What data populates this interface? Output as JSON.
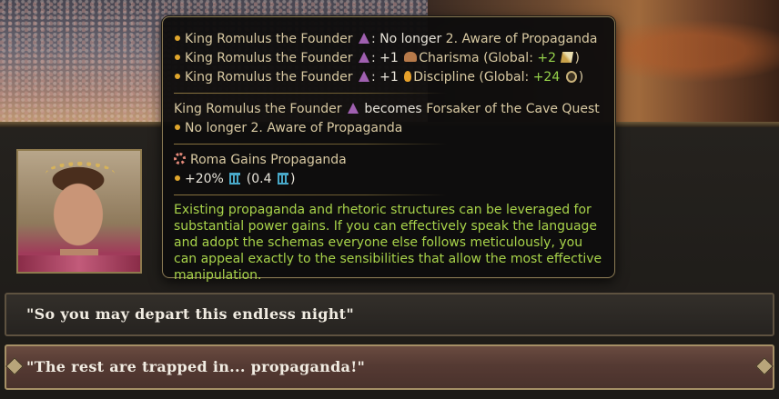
{
  "tooltip": {
    "effects": [
      {
        "name": "King Romulus the Founder",
        "text": ": No longer ",
        "value": "2. Aware of Propaganda"
      },
      {
        "name": "King Romulus the Founder",
        "text": ": +1 ",
        "stat": "Charisma",
        "global_prefix": " (Global: ",
        "global_value": "+2",
        "global_suffix": ")"
      },
      {
        "name": "King Romulus the Founder",
        "text": ": +1 ",
        "stat": "Discipline",
        "global_prefix": " (Global: ",
        "global_value": "+24",
        "global_suffix": ")"
      }
    ],
    "quest": {
      "name": "King Romulus the Founder",
      "becomes": " becomes ",
      "quest_name": "Forsaker of the Cave Quest",
      "no_longer": "No longer 2. Aware of Propaganda"
    },
    "gain": {
      "title": "Roma Gains Propaganda",
      "value": "+20%",
      "paren_open": " (0.4 ",
      "paren_close": ")"
    },
    "description": "Existing propaganda and rhetoric structures can be leveraged for substantial power gains. If you can effectively speak the language and adopt the schemas everyone else follows meticulously, you can appeal exactly to the sensibilities that allow the most effective manipulation."
  },
  "choices": [
    {
      "label": "\"So you may depart this endless night\""
    },
    {
      "label": "\"The rest are trapped in... propaganda!\""
    }
  ],
  "icons": {
    "character": "character-triangle-icon",
    "charisma": "charisma-heart-icon",
    "discipline": "discipline-flame-icon",
    "global_charisma": "quill-icon",
    "global_discipline": "medal-icon",
    "propaganda": "propaganda-gear-icon",
    "structure": "pillar-icon"
  },
  "colors": {
    "accent_green": "#95d14a",
    "gold_text": "#d8c9a2",
    "bullet": "#e0a62c",
    "character_icon": "#a060b0",
    "structure_icon": "#48a8c8"
  }
}
